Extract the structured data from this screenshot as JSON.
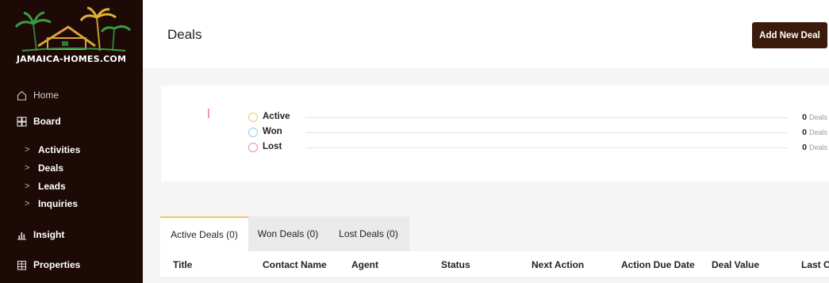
{
  "brand": {
    "logo_text": "JAMAICA-HOMES.COM"
  },
  "sidebar": {
    "home_label": "Home",
    "board_label": "Board",
    "sub_items": [
      {
        "label": "Activities"
      },
      {
        "label": "Deals"
      },
      {
        "label": "Leads"
      },
      {
        "label": "Inquiries"
      }
    ],
    "insight_label": "Insight",
    "properties_label": "Properties"
  },
  "header": {
    "title": "Deals",
    "add_button_label": "Add New Deal"
  },
  "stats": [
    {
      "name": "Active",
      "count": "0",
      "unit": "Deals",
      "color": "#f1c95b"
    },
    {
      "name": "Won",
      "count": "0",
      "unit": "Deals",
      "color": "#8fd0e8"
    },
    {
      "name": "Lost",
      "count": "0",
      "unit": "Deals",
      "color": "#f28a9a"
    }
  ],
  "tabs": [
    {
      "label": "Active Deals (0)",
      "active": true
    },
    {
      "label": "Won Deals (0)",
      "active": false
    },
    {
      "label": "Lost Deals (0)",
      "active": false
    }
  ],
  "table": {
    "columns": [
      "Title",
      "Contact Name",
      "Agent",
      "Status",
      "Next Action",
      "Action Due Date",
      "Deal Value",
      "Last Co"
    ]
  },
  "colors": {
    "sidebar_bg": "#1d0a06",
    "button_bg": "#3b1c0c",
    "active_tab_accent": "#f1c95b"
  }
}
